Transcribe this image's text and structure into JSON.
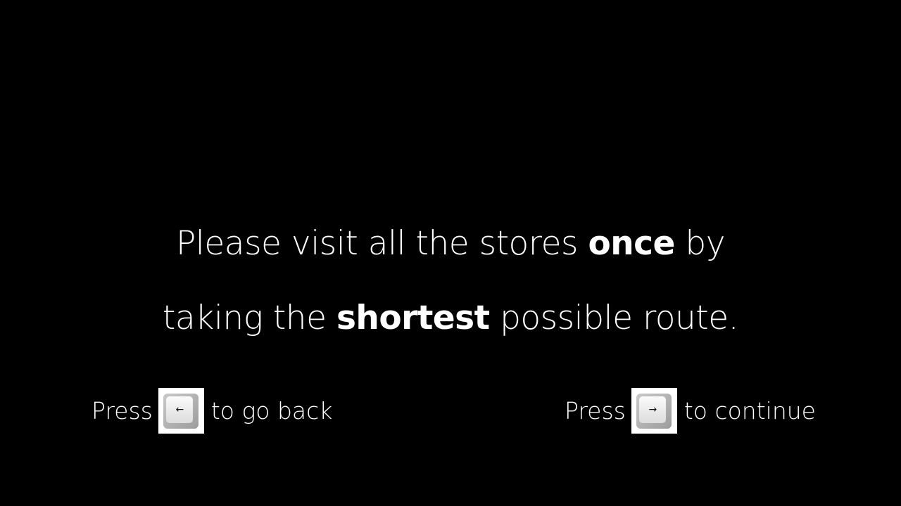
{
  "instruction": {
    "line1": {
      "part1": "Please visit all the stores ",
      "bold": "once",
      "part2": " by"
    },
    "line2": {
      "part1": "taking the ",
      "bold": "shortest",
      "part2": " possible route."
    }
  },
  "navigation": {
    "back": {
      "press_label": "Press",
      "key_glyph": "←",
      "key_icon": "left-arrow-key-icon",
      "action_label": "to go back"
    },
    "forward": {
      "press_label": "Press",
      "key_glyph": "→",
      "key_icon": "right-arrow-key-icon",
      "action_label": "to continue"
    }
  },
  "colors": {
    "background": "#000000",
    "text": "#ffffff"
  }
}
